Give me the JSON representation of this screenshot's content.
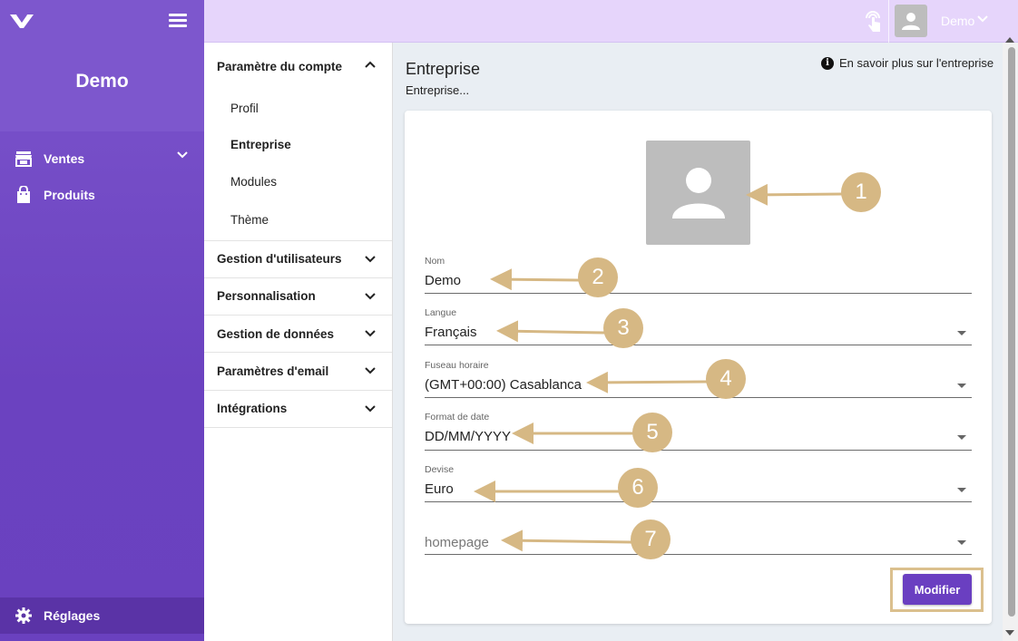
{
  "sidebar": {
    "title": "Demo",
    "items": [
      {
        "label": "Ventes",
        "icon": "store-icon"
      },
      {
        "label": "Produits",
        "icon": "shopping-bag-icon"
      }
    ],
    "bottom_label": "Réglages"
  },
  "topbar": {
    "user_name": "Demo"
  },
  "settings_nav": {
    "sections": [
      {
        "label": "Paramètre du compte",
        "expanded": true,
        "children": [
          "Profil",
          "Entreprise",
          "Modules",
          "Thème"
        ]
      },
      {
        "label": "Gestion d'utilisateurs"
      },
      {
        "label": "Personnalisation"
      },
      {
        "label": "Gestion de données"
      },
      {
        "label": "Paramètres d'email"
      },
      {
        "label": "Intégrations"
      }
    ],
    "active": "Entreprise"
  },
  "main": {
    "title": "Entreprise",
    "subtitle": "Entreprise...",
    "learn_more": "En savoir plus sur l'entreprise",
    "fields": {
      "nom": {
        "label": "Nom",
        "value": "Demo"
      },
      "langue": {
        "label": "Langue",
        "value": "Français"
      },
      "fuseau": {
        "label": "Fuseau horaire",
        "value": "(GMT+00:00) Casablanca"
      },
      "format_date": {
        "label": "Format de date",
        "value": "DD/MM/YYYY"
      },
      "devise": {
        "label": "Devise",
        "value": "Euro"
      },
      "homepage": {
        "placeholder": "homepage"
      }
    },
    "submit_label": "Modifier"
  },
  "annotations": [
    "1",
    "2",
    "3",
    "4",
    "5",
    "6",
    "7"
  ],
  "colors": {
    "sidebar": "#7c55cc",
    "sidebar_active": "#5a33a6",
    "topbar": "#e6d5fb",
    "primary_button": "#6a3fc1",
    "annotation": "#d6b884"
  }
}
